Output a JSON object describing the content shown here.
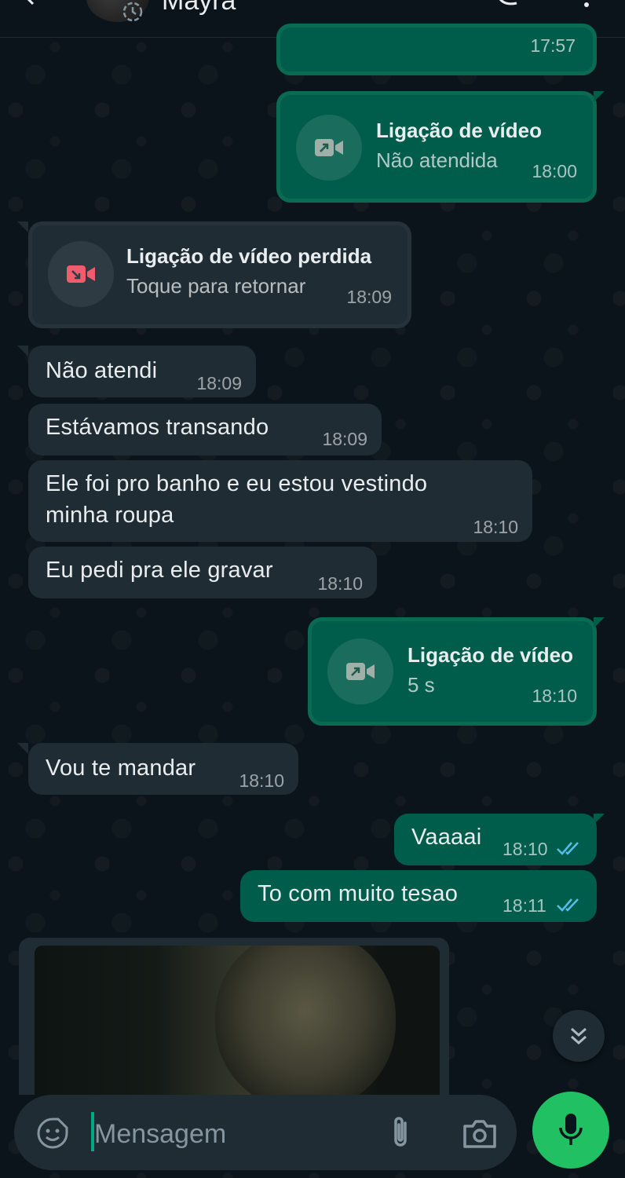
{
  "header": {
    "contact_name": "Mayra"
  },
  "messages": [
    {
      "type": "call-out",
      "time": "17:57"
    },
    {
      "type": "call-out",
      "title": "Ligação de vídeo",
      "subtitle": "Não atendida",
      "time": "18:00"
    },
    {
      "type": "call-in-missed",
      "title": "Ligação de vídeo perdida",
      "subtitle": "Toque para retornar",
      "time": "18:09"
    },
    {
      "type": "text-in",
      "text": "Não atendi",
      "time": "18:09"
    },
    {
      "type": "text-in",
      "text": "Estávamos transando",
      "time": "18:09"
    },
    {
      "type": "text-in",
      "line1": "Ele foi pro banho e eu estou vestindo",
      "line2": "minha roupa",
      "time": "18:10"
    },
    {
      "type": "text-in",
      "text": "Eu pedi pra ele gravar",
      "time": "18:10"
    },
    {
      "type": "call-out",
      "title": "Ligação de vídeo",
      "subtitle": "5 s",
      "time": "18:10"
    },
    {
      "type": "text-in",
      "text": "Vou te mandar",
      "time": "18:10"
    },
    {
      "type": "text-out",
      "text": "Vaaaai",
      "time": "18:10",
      "status": "read"
    },
    {
      "type": "text-out",
      "text": "To com muito tesao",
      "time": "18:11",
      "status": "read"
    },
    {
      "type": "video-in"
    }
  ],
  "composer": {
    "placeholder": "Mensagem"
  },
  "colors": {
    "outgoing_bubble": "#005c4b",
    "incoming_bubble": "#202c33",
    "background": "#0b141a",
    "accent_green": "#21c063",
    "read_ticks": "#53bdeb",
    "missed_call_red": "#f15c6d"
  },
  "icons": [
    "back-arrow-icon",
    "status-ring-icon",
    "voice-call-icon",
    "menu-icon",
    "video-call-icon",
    "missed-video-call-icon",
    "double-check-icon",
    "chevrons-down-icon",
    "sticker-icon",
    "attach-icon",
    "camera-icon",
    "mic-icon"
  ]
}
